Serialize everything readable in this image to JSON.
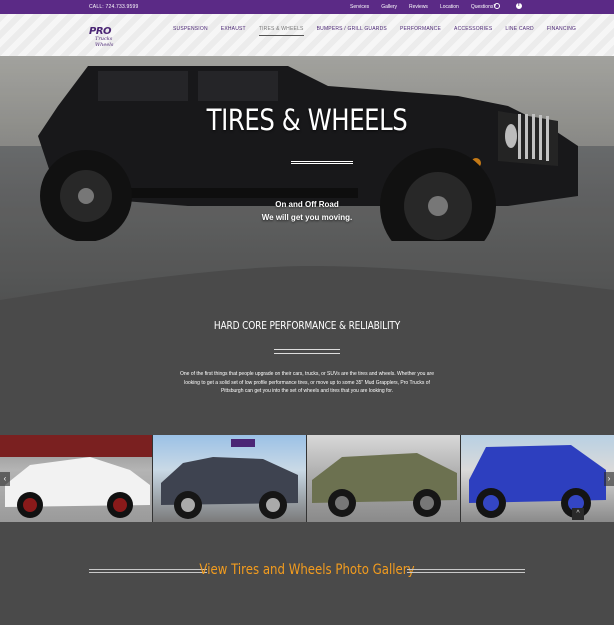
{
  "topbar": {
    "call": "CALL: 724.733.9599",
    "links": [
      "Services",
      "Gallery",
      "Reviews",
      "Location",
      "Questions?"
    ]
  },
  "header": {
    "logo_text": "PRO",
    "logo_sub": "Trucks Wheels",
    "nav": [
      "SUSPENSION",
      "EXHAUST",
      "TIRES & WHEELS",
      "BUMPERS / GRILL GUARDS",
      "PERFORMANCE",
      "ACCESSORIES",
      "LINE CARD",
      "FINANCING"
    ],
    "active_index": 2
  },
  "hero": {
    "title": "TIRES & WHEELS",
    "sub1": "On and Off Road",
    "sub2": "We will get you moving."
  },
  "section": {
    "title": "HARD CORE PERFORMANCE & RELIABILITY",
    "body": "One of the first things that people upgrade on their cars, trucks, or SUVs are the tires and wheels. Whether you are looking to get a solid set of low profile performance tires, or move up to some 35\" Mud Grapplers, Pro Trucks of Pittsburgh can get you into the set of wheels and tires that you are looking for."
  },
  "gallery": {
    "photos": [
      "white-hatchback-photo",
      "gray-pickup-photo",
      "green-subaru-photo",
      "blue-jeep-photo"
    ]
  },
  "cta": {
    "label": "View Tires and Wheels Photo Gallery"
  },
  "colors": {
    "topbar": "#5b2a86",
    "accent": "#f39c1e",
    "body_bg": "#4a4a4a"
  }
}
